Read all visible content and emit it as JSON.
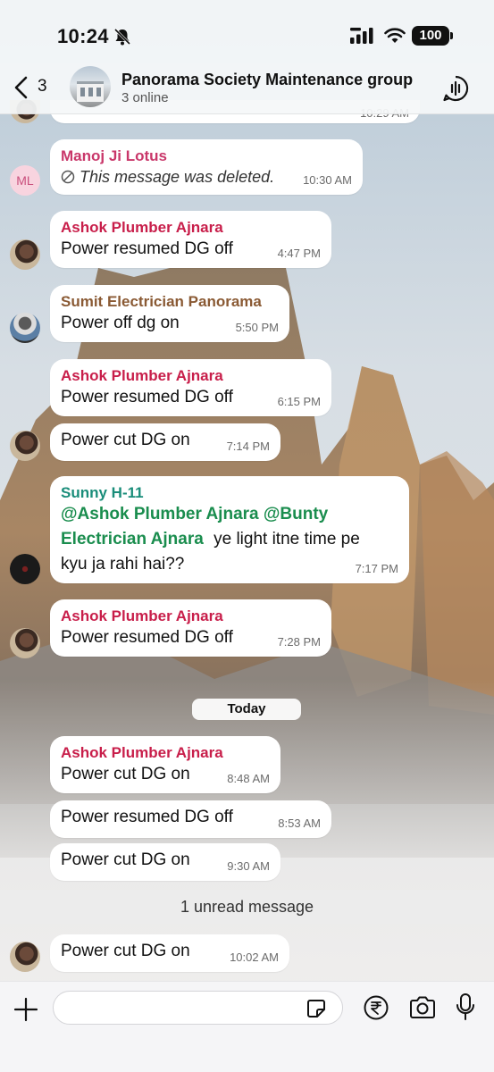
{
  "status": {
    "time": "10:24",
    "battery": "100"
  },
  "header": {
    "back_count": "3",
    "group_name": "Panorama Society Maintenance group",
    "subtitle": "3 online"
  },
  "top_partial_time": "10:29 AM",
  "messages": [
    {
      "sender": "Manoj Ji Lotus",
      "sender_color": "#c9376a",
      "avatar": "ML",
      "text": "This message was deleted.",
      "time": "10:30 AM"
    },
    {
      "sender": "Ashok Plumber Ajnara",
      "sender_color": "#c81e4a",
      "text": "Power resumed DG off",
      "time": "4:47 PM"
    },
    {
      "sender": "Sumit Electrician Panorama",
      "sender_color": "#8a5a34",
      "text": "Power off dg on",
      "time": "5:50 PM"
    },
    {
      "sender": "Ashok Plumber Ajnara",
      "sender_color": "#c81e4a",
      "text": "Power resumed DG off",
      "time": "6:15 PM"
    },
    {
      "text": "Power cut DG on",
      "time": "7:14 PM"
    },
    {
      "sender": "Sunny H-11",
      "sender_color": "#1a8d7a",
      "mention1": "@Ashok Plumber Ajnara",
      "mention2a": "@Bunty",
      "mention2b": "Electrician Ajnara",
      "text_tail": "ye light itne time pe",
      "text_line3": "kyu ja rahi hai??",
      "time": "7:17 PM"
    },
    {
      "sender": "Ashok Plumber Ajnara",
      "sender_color": "#c81e4a",
      "text": "Power resumed DG off",
      "time": "7:28 PM"
    },
    {
      "sender": "Ashok Plumber Ajnara",
      "sender_color": "#c81e4a",
      "text": "Power cut DG on",
      "time": "8:48 AM"
    },
    {
      "text": "Power resumed DG off",
      "time": "8:53 AM"
    },
    {
      "text": "Power cut DG on",
      "time": "9:30 AM"
    },
    {
      "text": "Power cut DG on",
      "time": "10:02 AM"
    }
  ],
  "day_separator": "Today",
  "unread_label": "1 unread message",
  "input": {
    "placeholder": ""
  },
  "icons": [
    "bell-off-icon",
    "signal-icon",
    "wifi-icon",
    "back-chevron-icon",
    "voice-chat-icon",
    "plus-icon",
    "sticker-icon",
    "rupee-icon",
    "camera-icon",
    "mic-icon"
  ]
}
